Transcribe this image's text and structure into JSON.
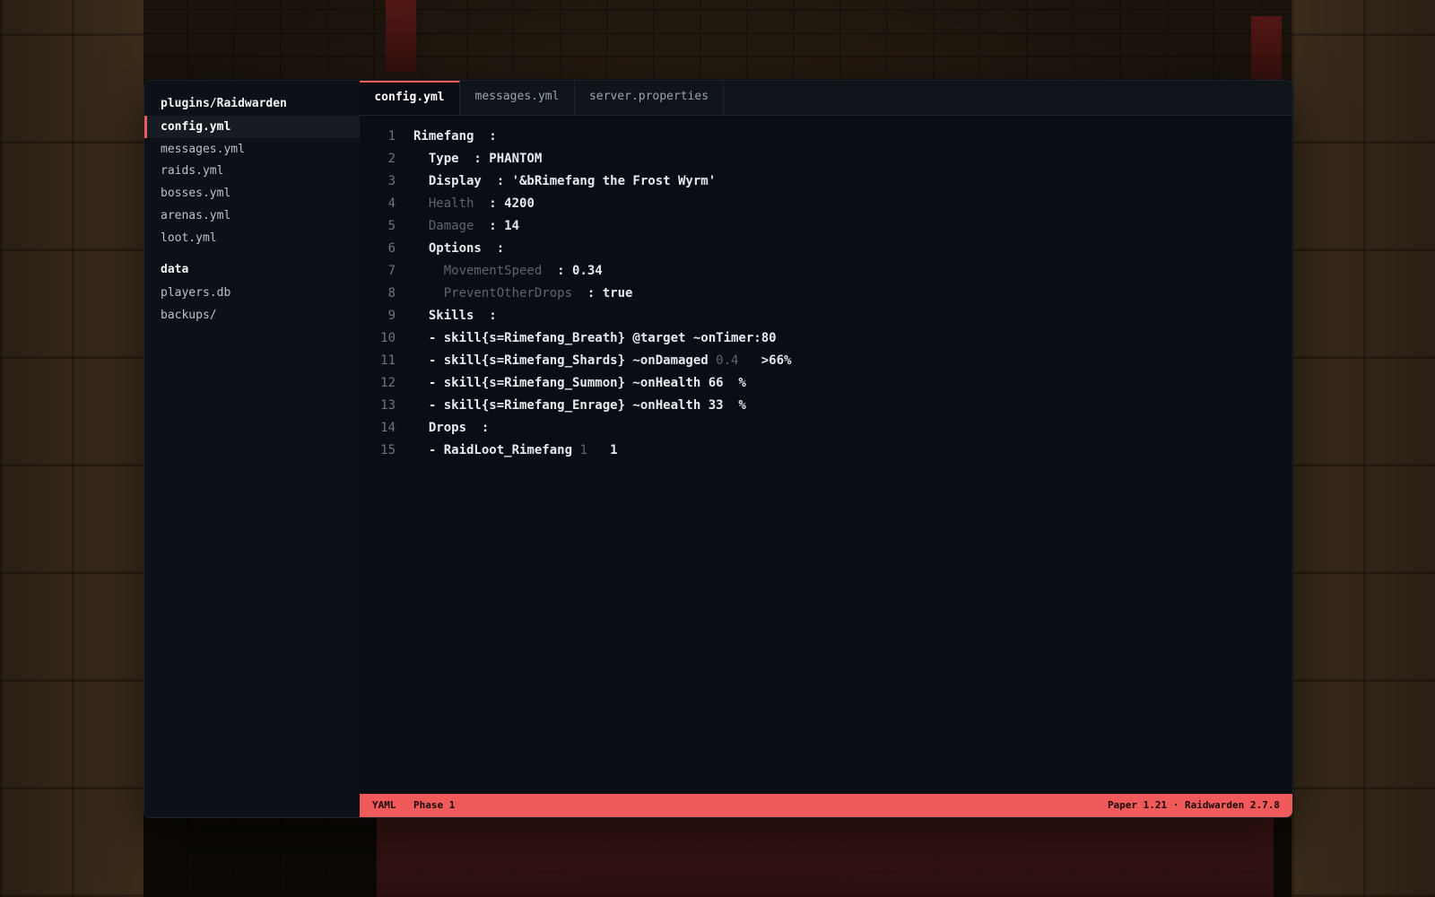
{
  "sidebar": {
    "folders": [
      {
        "title": "plugins/Raidwarden",
        "items": [
          {
            "label": "config.yml",
            "active": true
          },
          {
            "label": "messages.yml"
          },
          {
            "label": "raids.yml"
          },
          {
            "label": "bosses.yml"
          },
          {
            "label": "arenas.yml"
          },
          {
            "label": "loot.yml"
          }
        ]
      },
      {
        "title": "data",
        "items": [
          {
            "label": "players.db"
          },
          {
            "label": "backups/"
          }
        ]
      }
    ]
  },
  "tabs": [
    {
      "label": "config.yml",
      "active": true
    },
    {
      "label": "messages.yml"
    },
    {
      "label": "server.properties"
    }
  ],
  "code": {
    "lines": [
      {
        "n": "1",
        "segments": [
          {
            "t": "Rimefang  :"
          }
        ]
      },
      {
        "n": "2",
        "segments": [
          {
            "t": "  Type  : PHANTOM"
          }
        ]
      },
      {
        "n": "3",
        "segments": [
          {
            "t": "  Display  : '&bRimefang the Frost Wyrm'"
          }
        ]
      },
      {
        "n": "4",
        "segments": [
          {
            "t": "  Health  ",
            "s": "dim"
          },
          {
            "t": ": 4200"
          }
        ]
      },
      {
        "n": "5",
        "segments": [
          {
            "t": "  Damage  ",
            "s": "dim"
          },
          {
            "t": ": 14"
          }
        ]
      },
      {
        "n": "6",
        "segments": [
          {
            "t": "  Options  :"
          }
        ]
      },
      {
        "n": "7",
        "segments": [
          {
            "t": "    MovementSpeed  ",
            "s": "dim"
          },
          {
            "t": ": 0.34"
          }
        ]
      },
      {
        "n": "8",
        "segments": [
          {
            "t": "    PreventOtherDrops  ",
            "s": "dim"
          },
          {
            "t": ": true"
          }
        ]
      },
      {
        "n": "9",
        "segments": [
          {
            "t": "  Skills  :"
          }
        ]
      },
      {
        "n": "10",
        "segments": [
          {
            "t": "  - skill{s=Rimefang_Breath} @target ~onTimer:80"
          }
        ]
      },
      {
        "n": "11",
        "segments": [
          {
            "t": "  - skill{s=Rimefang_Shards} ~onDamaged "
          },
          {
            "t": "0.4",
            "s": "dim"
          },
          {
            "t": "   >66%"
          }
        ]
      },
      {
        "n": "12",
        "segments": [
          {
            "t": "  - skill{s=Rimefang_Summon} ~onHealth 66  %"
          }
        ]
      },
      {
        "n": "13",
        "segments": [
          {
            "t": "  - skill{s=Rimefang_Enrage} ~onHealth 33  %"
          }
        ]
      },
      {
        "n": "14",
        "segments": [
          {
            "t": "  Drops  :"
          }
        ]
      },
      {
        "n": "15",
        "segments": [
          {
            "t": "  - RaidLoot_Rimefang "
          },
          {
            "t": "1",
            "s": "dim"
          },
          {
            "t": "   1"
          }
        ]
      }
    ]
  },
  "statusbar": {
    "language": "YAML",
    "phase": "Phase 1",
    "right": "Paper 1.21 · Raidwarden 2.7.8"
  },
  "colors": {
    "accent": "#f05a5a",
    "background": "#0a0d13",
    "sidebar": "#0d1117"
  }
}
